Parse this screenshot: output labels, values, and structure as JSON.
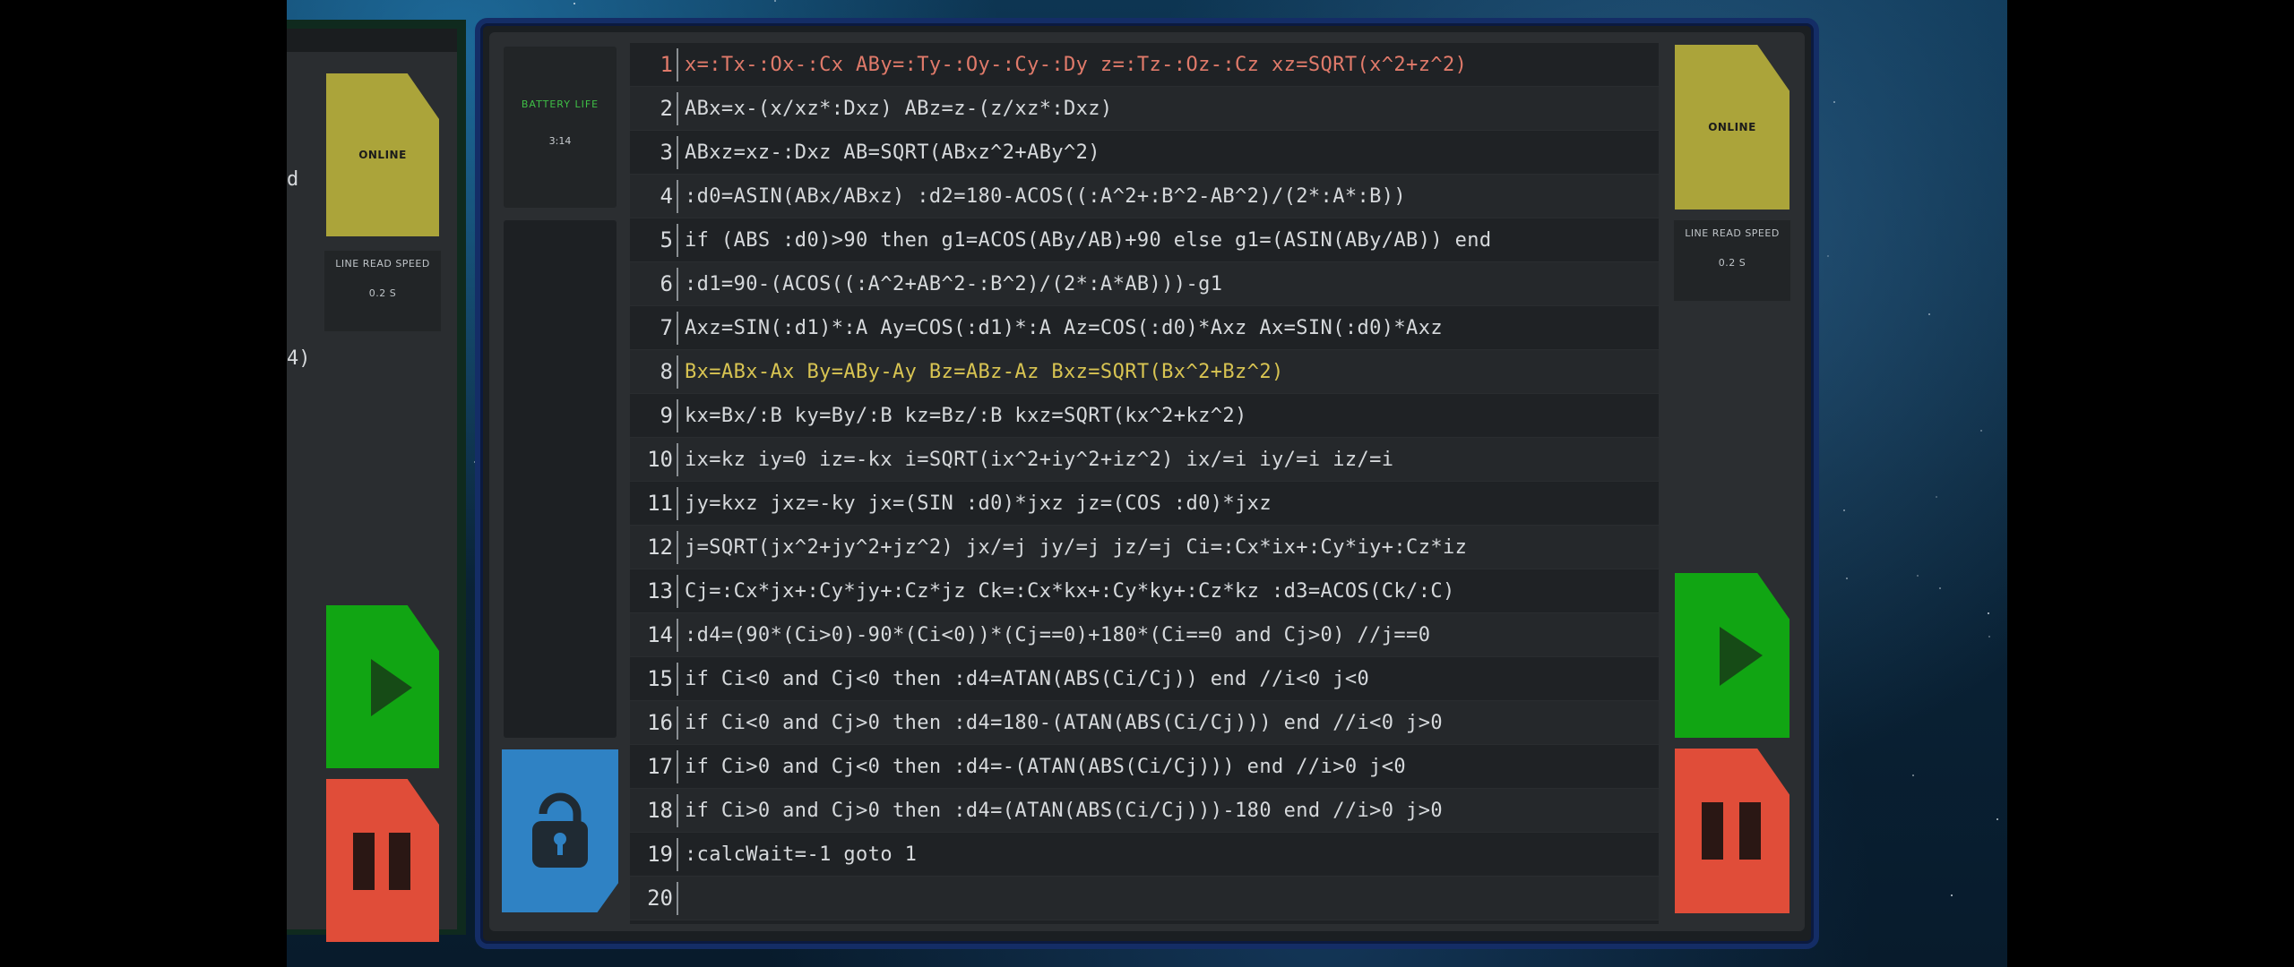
{
  "left_panel": {
    "status_label": "ONLINE",
    "speed_title": "LINE READ SPEED",
    "speed_value": "0.2 S",
    "cut_text_1": "d",
    "cut_text_2": "4)"
  },
  "main_chip": {
    "battery_title": "BATTERY LIFE",
    "battery_value": "3:14",
    "lock_icon": "lock-icon"
  },
  "right_panel": {
    "status_label": "ONLINE",
    "speed_title": "LINE READ SPEED",
    "speed_value": "0.2 S"
  },
  "code": {
    "lines": [
      {
        "n": "1",
        "text": "x=:Tx-:Ox-:Cx ABy=:Ty-:Oy-:Cy-:Dy z=:Tz-:Oz-:Cz xz=SQRT(x^2+z^2)",
        "state": "error"
      },
      {
        "n": "2",
        "text": "ABx=x-(x/xz*:Dxz) ABz=z-(z/xz*:Dxz)",
        "state": "normal"
      },
      {
        "n": "3",
        "text": "ABxz=xz-:Dxz AB=SQRT(ABxz^2+ABy^2)",
        "state": "normal"
      },
      {
        "n": "4",
        "text": ":d0=ASIN(ABx/ABxz) :d2=180-ACOS((:A^2+:B^2-AB^2)/(2*:A*:B))",
        "state": "normal"
      },
      {
        "n": "5",
        "text": "if (ABS :d0)>90 then g1=ACOS(ABy/AB)+90 else g1=(ASIN(ABy/AB)) end",
        "state": "normal"
      },
      {
        "n": "6",
        "text": ":d1=90-(ACOS((:A^2+AB^2-:B^2)/(2*:A*AB)))-g1",
        "state": "normal"
      },
      {
        "n": "7",
        "text": "Axz=SIN(:d1)*:A Ay=COS(:d1)*:A Az=COS(:d0)*Axz Ax=SIN(:d0)*Axz",
        "state": "normal"
      },
      {
        "n": "8",
        "text": "Bx=ABx-Ax By=ABy-Ay Bz=ABz-Az Bxz=SQRT(Bx^2+Bz^2)",
        "state": "current"
      },
      {
        "n": "9",
        "text": "kx=Bx/:B ky=By/:B kz=Bz/:B kxz=SQRT(kx^2+kz^2)",
        "state": "normal"
      },
      {
        "n": "10",
        "text": "ix=kz iy=0 iz=-kx i=SQRT(ix^2+iy^2+iz^2) ix/=i iy/=i iz/=i",
        "state": "normal"
      },
      {
        "n": "11",
        "text": "jy=kxz jxz=-ky jx=(SIN :d0)*jxz jz=(COS :d0)*jxz",
        "state": "normal"
      },
      {
        "n": "12",
        "text": "j=SQRT(jx^2+jy^2+jz^2) jx/=j jy/=j jz/=j Ci=:Cx*ix+:Cy*iy+:Cz*iz",
        "state": "normal"
      },
      {
        "n": "13",
        "text": "Cj=:Cx*jx+:Cy*jy+:Cz*jz Ck=:Cx*kx+:Cy*ky+:Cz*kz :d3=ACOS(Ck/:C)",
        "state": "normal"
      },
      {
        "n": "14",
        "text": ":d4=(90*(Ci>0)-90*(Ci<0))*(Cj==0)+180*(Ci==0 and Cj>0) //j==0",
        "state": "normal"
      },
      {
        "n": "15",
        "text": "if Ci<0 and Cj<0 then :d4=ATAN(ABS(Ci/Cj)) end //i<0 j<0",
        "state": "normal"
      },
      {
        "n": "16",
        "text": "if Ci<0 and Cj>0 then :d4=180-(ATAN(ABS(Ci/Cj))) end //i<0 j>0",
        "state": "normal"
      },
      {
        "n": "17",
        "text": "if Ci>0 and Cj<0 then :d4=-(ATAN(ABS(Ci/Cj))) end //i>0 j<0",
        "state": "normal"
      },
      {
        "n": "18",
        "text": "if Ci>0 and Cj>0 then :d4=(ATAN(ABS(Ci/Cj)))-180 end //i>0 j>0",
        "state": "normal"
      },
      {
        "n": "19",
        "text": ":calcWait=-1 goto 1",
        "state": "normal"
      },
      {
        "n": "20",
        "text": "",
        "state": "normal"
      }
    ]
  },
  "colors": {
    "error_text": "#e07a6a",
    "current_text": "#d8c452",
    "online_badge": "#aba43a",
    "play": "#11a513",
    "pause": "#e04d39",
    "lock": "#2f82c4",
    "battery_title": "#3fbf46",
    "frame": "#142d66"
  }
}
